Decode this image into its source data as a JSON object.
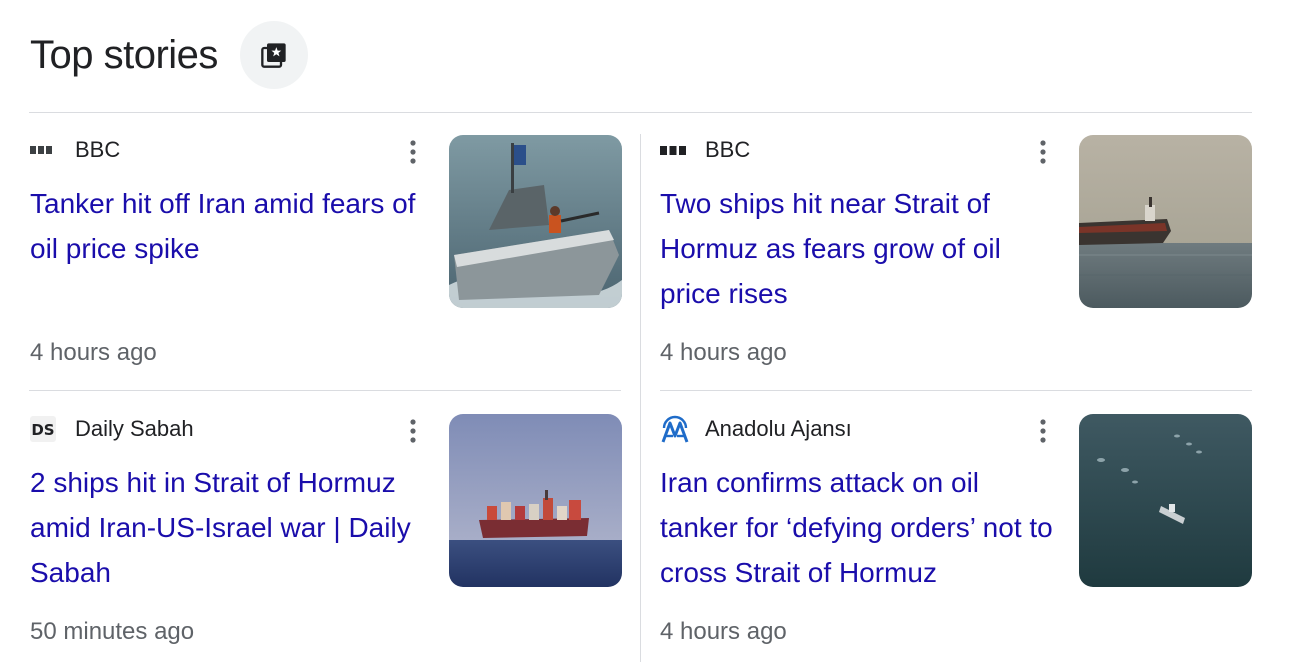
{
  "header": {
    "title": "Top stories"
  },
  "stories": [
    {
      "source": "BBC",
      "headline": "Tanker hit off Iran amid fears of oil price spike",
      "time": "4 hours ago"
    },
    {
      "source": "BBC",
      "headline": "Two ships hit near Strait of Hormuz as fears grow of oil price rises",
      "time": "4 hours ago"
    },
    {
      "source": "Daily Sabah",
      "headline": "2 ships hit in Strait of Hormuz amid Iran-US-Israel war | Daily Sabah",
      "time": "50 minutes ago",
      "logo_text": "DS"
    },
    {
      "source": "Anadolu Ajansı",
      "headline": "Iran confirms attack on oil tanker for ‘defying orders’ not to cross Strait of Hormuz",
      "time": "4 hours ago"
    }
  ],
  "colors": {
    "link": "#1a0dab",
    "meta": "#5f6368",
    "divider": "#dadce0",
    "anadolu_blue": "#1f6cc9"
  },
  "icons": {
    "header_button": "bookmark-star-icon",
    "more": "more-vert-icon"
  }
}
